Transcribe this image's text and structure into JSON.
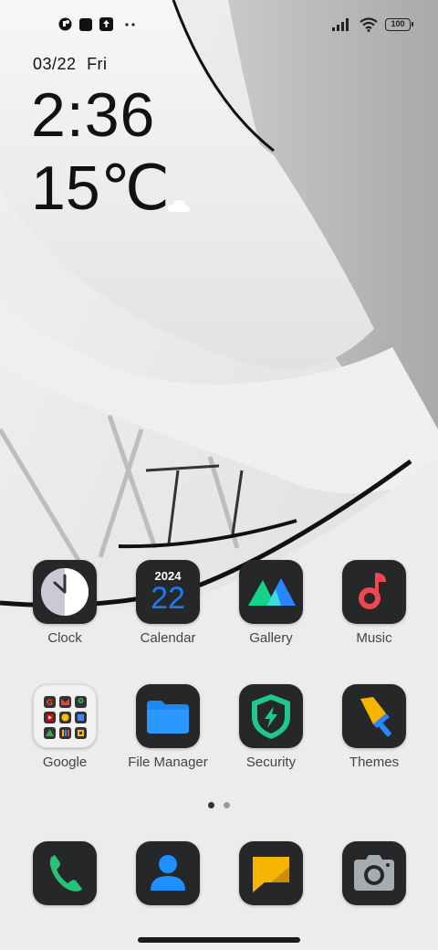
{
  "status_bar": {
    "battery": "100",
    "left_icons": [
      "notification-icon",
      "square-app-icon",
      "upload-icon",
      "more-dots-icon"
    ],
    "right_icons": [
      "signal-icon",
      "wifi-icon",
      "battery-icon"
    ]
  },
  "widget": {
    "date": "03/22",
    "weekday": "Fri",
    "time": "2:36",
    "temperature": "15℃",
    "weather_icon": "cloud-icon"
  },
  "apps": {
    "clock": "Clock",
    "calendar": "Calendar",
    "calendar_year": "2024",
    "calendar_day": "22",
    "gallery": "Gallery",
    "music": "Music",
    "google": "Google",
    "file_manager": "File Manager",
    "security": "Security",
    "themes": "Themes"
  },
  "dock": [
    "phone-icon",
    "contacts-icon",
    "messages-icon",
    "camera-icon"
  ],
  "pages": {
    "count": 2,
    "active": 1
  },
  "colors": {
    "icon_dark": "#262729",
    "calendar_blue": "#1f7bf2",
    "music_red": "#f0484f",
    "security_green": "#1fc98a",
    "phone_green": "#27c178",
    "contacts_blue": "#1e90ff",
    "messages_yellow": "#f6b500"
  }
}
